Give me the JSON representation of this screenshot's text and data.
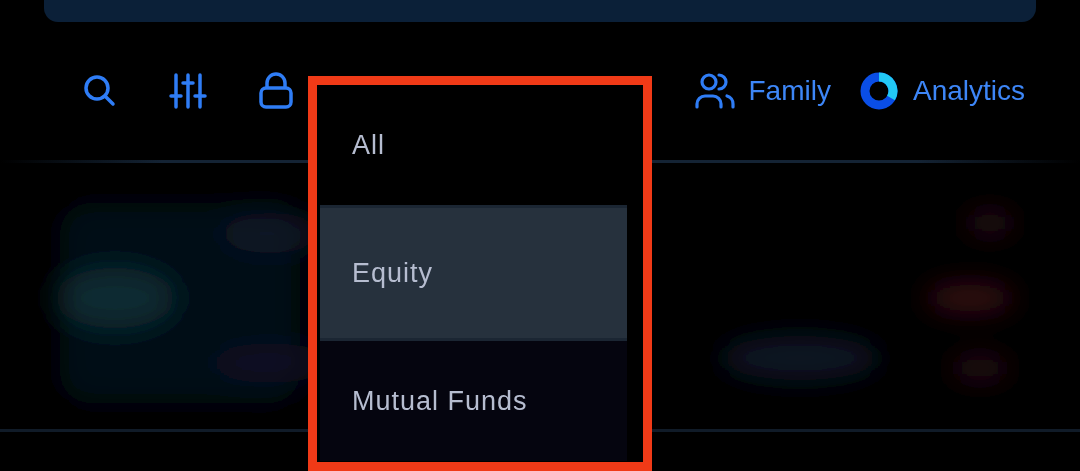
{
  "toolbar": {
    "icons": [
      {
        "kind": "search"
      },
      {
        "kind": "sliders"
      },
      {
        "kind": "lock"
      }
    ],
    "links": [
      {
        "kind": "people",
        "label": "Family"
      },
      {
        "kind": "donut",
        "label": "Analytics"
      }
    ]
  },
  "dropdown": {
    "items": [
      {
        "label": "All",
        "selected": false
      },
      {
        "label": "Equity",
        "selected": true
      },
      {
        "label": "Mutual Funds",
        "selected": false
      }
    ]
  }
}
